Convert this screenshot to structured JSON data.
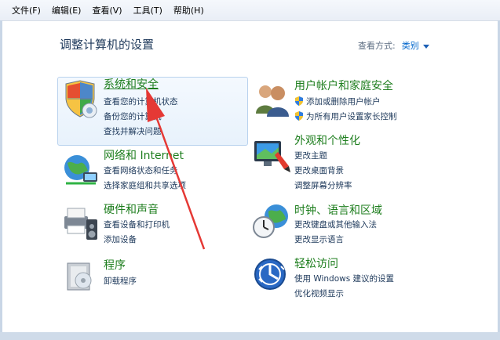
{
  "menu": [
    "文件(F)",
    "编辑(E)",
    "查看(V)",
    "工具(T)",
    "帮助(H)"
  ],
  "page_title": "调整计算机的设置",
  "view_mode": {
    "label": "查看方式:",
    "value": "类别"
  },
  "categories": {
    "system_security": {
      "title": "系统和安全",
      "icon": "shield-pc-icon",
      "tasks": [
        "查看您的计算机状态",
        "备份您的计算机",
        "查找并解决问题"
      ]
    },
    "user_accounts": {
      "title": "用户帐户和家庭安全",
      "icon": "users-icon",
      "tasks": [
        "添加或删除用户帐户",
        "为所有用户设置家长控制"
      ]
    },
    "network_internet": {
      "title": "网络和 Internet",
      "icon": "globe-network-icon",
      "tasks": [
        "查看网络状态和任务",
        "选择家庭组和共享选项"
      ]
    },
    "appearance": {
      "title": "外观和个性化",
      "icon": "monitor-paint-icon",
      "tasks": [
        "更改主题",
        "更改桌面背景",
        "调整屏幕分辨率"
      ]
    },
    "hardware_sound": {
      "title": "硬件和声音",
      "icon": "printer-speaker-icon",
      "tasks": [
        "查看设备和打印机",
        "添加设备"
      ]
    },
    "clock_region": {
      "title": "时钟、语言和区域",
      "icon": "clock-globe-icon",
      "tasks": [
        "更改键盘或其他输入法",
        "更改显示语言"
      ]
    },
    "programs": {
      "title": "程序",
      "icon": "programs-box-icon",
      "tasks": [
        "卸载程序"
      ]
    },
    "ease_of_access": {
      "title": "轻松访问",
      "icon": "ease-of-access-icon",
      "tasks": [
        "使用 Windows 建议的设置",
        "优化视频显示"
      ]
    }
  },
  "colors": {
    "title_green": "#1e7e1e",
    "link_blue": "#1e395b",
    "highlight_border": "#b9d2ee",
    "arrow_red": "#e53935"
  }
}
